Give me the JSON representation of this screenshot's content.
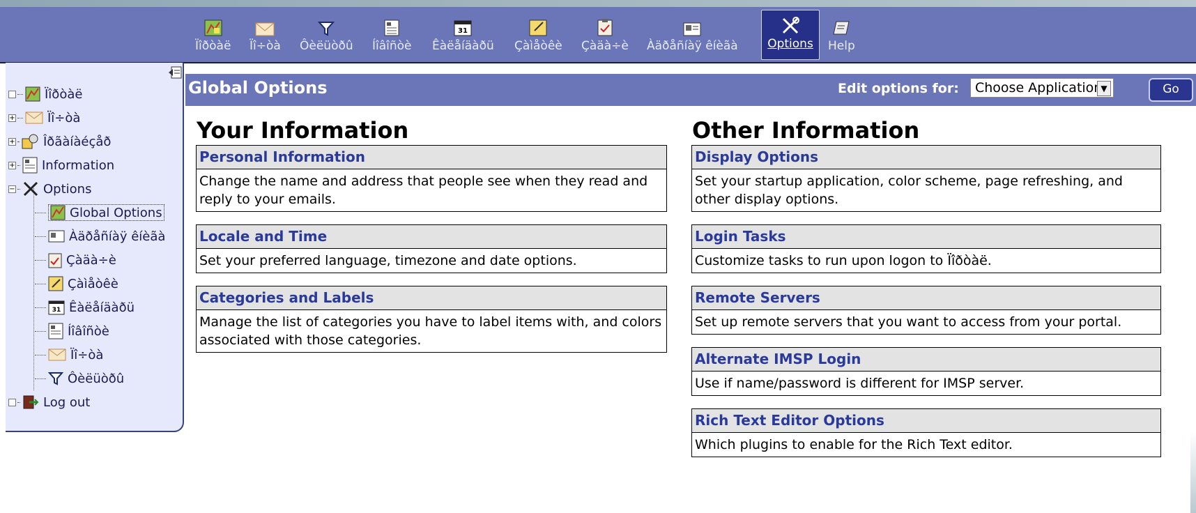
{
  "toolbar": {
    "items": [
      {
        "label": "Ïîðòàë",
        "icon": "portal-map-icon"
      },
      {
        "label": "Ïî÷òà",
        "icon": "mail-envelope-icon"
      },
      {
        "label": "Ôèëüòðû",
        "icon": "filter-funnel-icon"
      },
      {
        "label": "Íîâîñòè",
        "icon": "news-document-icon"
      },
      {
        "label": "Êàëåíäàðü",
        "icon": "calendar-icon"
      },
      {
        "label": "Çàìåòêè",
        "icon": "notes-pad-icon"
      },
      {
        "label": "Çàäà÷è",
        "icon": "tasks-clipboard-icon"
      },
      {
        "label": "Àäðåñíàÿ êíèãà",
        "icon": "address-book-icon"
      },
      {
        "label": "Options",
        "icon": "options-tools-icon"
      },
      {
        "label": "Help",
        "icon": "help-book-icon"
      }
    ]
  },
  "sidebar": {
    "items": [
      {
        "label": "Ïîðòàë",
        "expander": ""
      },
      {
        "label": "Ïî÷òà",
        "expander": "+"
      },
      {
        "label": "Îðãàíàéçåð",
        "expander": "+"
      },
      {
        "label": "Information",
        "expander": "+"
      },
      {
        "label": "Options",
        "expander": "−"
      },
      {
        "label": "Global Options"
      },
      {
        "label": "Àäðåñíàÿ êíèãà"
      },
      {
        "label": "Çàäà÷è"
      },
      {
        "label": "Çàìåòêè"
      },
      {
        "label": "Êàëåíäàðü"
      },
      {
        "label": "Íîâîñòè"
      },
      {
        "label": "Ïî÷òà"
      },
      {
        "label": "Ôèëüòðû"
      },
      {
        "label": "Log out",
        "expander": ""
      }
    ]
  },
  "header": {
    "title": "Global Options",
    "edit_label": "Edit options for:",
    "select_value": "Choose Application:",
    "go_label": "Go"
  },
  "left_column": {
    "title": "Your Information",
    "sections": [
      {
        "title": "Personal Information",
        "desc": "Change the name and address that people see when they read and reply to your emails."
      },
      {
        "title": "Locale and Time",
        "desc": "Set your preferred language, timezone and date options."
      },
      {
        "title": "Categories and Labels",
        "desc": "Manage the list of categories you have to label items with, and colors associated with those categories."
      }
    ]
  },
  "right_column": {
    "title": "Other Information",
    "sections": [
      {
        "title": "Display Options",
        "desc": "Set your startup application, color scheme, page refreshing, and other display options."
      },
      {
        "title": "Login Tasks",
        "desc": "Customize tasks to run upon logon to Ïîðòàë."
      },
      {
        "title": "Remote Servers",
        "desc": "Set up remote servers that you want to access from your portal."
      },
      {
        "title": "Alternate IMSP Login",
        "desc": "Use if name/password is different for IMSP server."
      },
      {
        "title": "Rich Text Editor Options",
        "desc": "Which plugins to enable for the Rich Text editor."
      }
    ]
  },
  "colors": {
    "bar": "#6b76b9",
    "sidebar_bg": "#e6e9fb",
    "link": "#2a3a9a",
    "active_tab": "#263089"
  }
}
